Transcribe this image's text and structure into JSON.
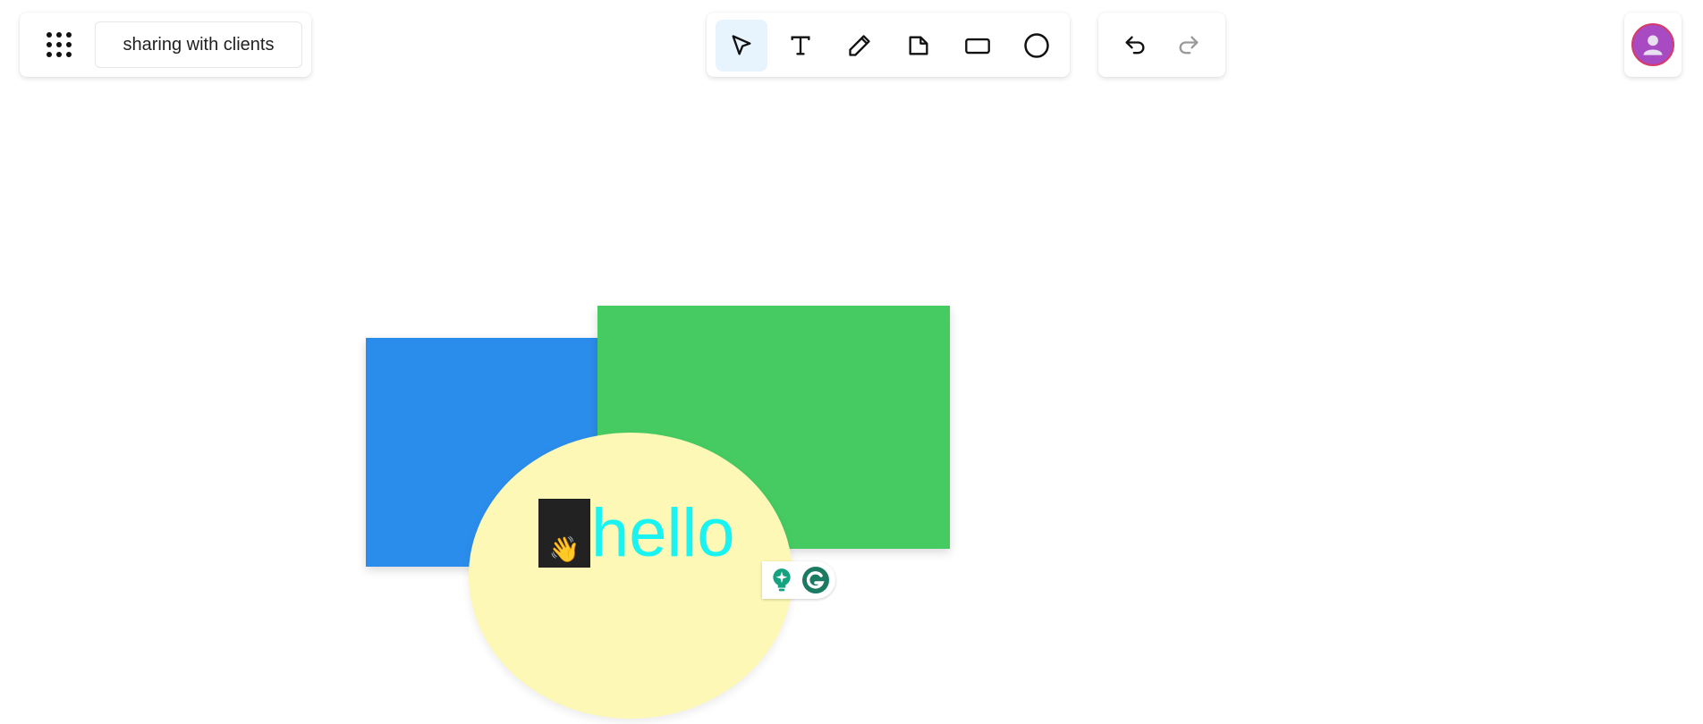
{
  "board": {
    "title": "sharing with clients"
  },
  "toolbar": {
    "tools": [
      {
        "icon": "select-cursor-icon",
        "active": true
      },
      {
        "icon": "text-tool-icon",
        "active": false
      },
      {
        "icon": "pencil-icon",
        "active": false
      },
      {
        "icon": "sticky-note-icon",
        "active": false
      },
      {
        "icon": "rectangle-icon",
        "active": false
      },
      {
        "icon": "ellipse-icon",
        "active": false
      }
    ],
    "active_color": "#e8f4fd"
  },
  "history": {
    "undo_icon": "undo-icon",
    "redo_icon": "redo-icon"
  },
  "user": {
    "avatar_color": "#a84bc2"
  },
  "canvas": {
    "shapes": [
      {
        "type": "rectangle",
        "color": "#2b8deb"
      },
      {
        "type": "rectangle",
        "color": "#46cb62"
      },
      {
        "type": "ellipse",
        "color": "#fdf8b5"
      }
    ],
    "text": {
      "emoji": "👋",
      "content": "hello",
      "color": "#19f3f1"
    }
  },
  "extension": {
    "name": "grammarly",
    "icons": [
      "lightbulb-icon",
      "grammarly-icon"
    ],
    "color": "#15a37f"
  }
}
